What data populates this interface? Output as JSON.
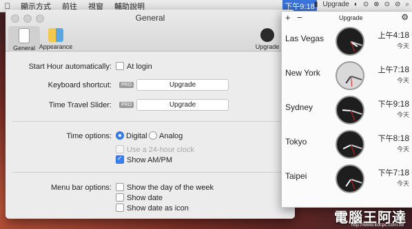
{
  "menubar": {
    "items": [
      "顯示方式",
      "前往",
      "視窗",
      "輔助說明"
    ],
    "clock": "下午9:18",
    "tray_upgrade": "Upgrade"
  },
  "window": {
    "title": "General",
    "toolbar": {
      "general": "General",
      "appearance": "Appearance",
      "upgrade": "Upgrade"
    },
    "start_hour_label": "Start Hour automatically:",
    "at_login": "At login",
    "keyboard_shortcut_label": "Keyboard shortcut:",
    "pro_badge": "PRO",
    "upgrade_button": "Upgrade",
    "time_travel_label": "Time Travel Slider:",
    "time_options_label": "Time options:",
    "digital": "Digital",
    "analog": "Analog",
    "use_24h": "Use a 24-hour clock",
    "show_ampm": "Show AM/PM",
    "menu_bar_options_label": "Menu bar options:",
    "show_day": "Show the day of the week",
    "show_date": "Show date",
    "show_date_icon": "Show date as icon"
  },
  "panel": {
    "plus": "+",
    "minus": "−",
    "upgrade": "Upgrade",
    "cities": [
      {
        "name": "Las Vegas",
        "ampm": "上午",
        "time": "4:18",
        "day": "今天"
      },
      {
        "name": "New York",
        "ampm": "上午",
        "time": "7:18",
        "day": "今天"
      },
      {
        "name": "Sydney",
        "ampm": "下午",
        "time": "9:18",
        "day": "今天"
      },
      {
        "name": "Tokyo",
        "ampm": "下午",
        "time": "8:18",
        "day": "今天"
      },
      {
        "name": "Taipei",
        "ampm": "下午",
        "time": "7:18",
        "day": "今天"
      }
    ]
  },
  "watermark": {
    "text": "電腦王阿達",
    "url": "http://www.kocpc.com.tw"
  }
}
